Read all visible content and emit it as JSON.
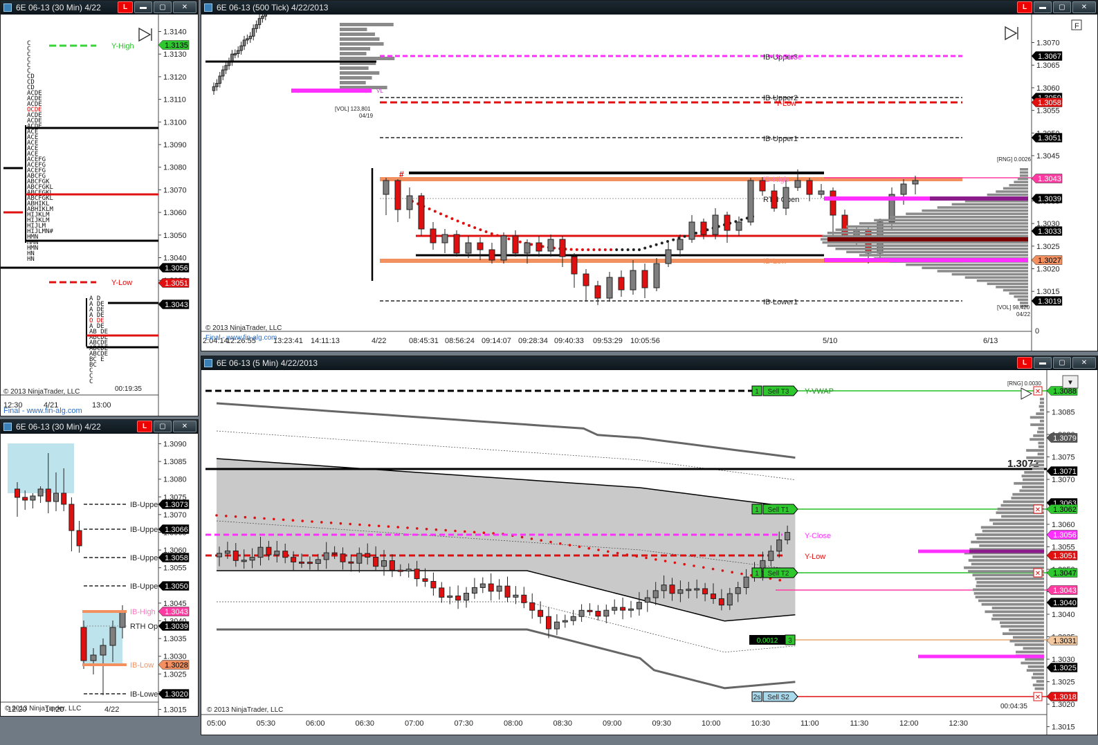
{
  "windows": {
    "tl": {
      "title": "6E 06-13 (30 Min)  4/22",
      "footer": "Final - www.fin-alg.com",
      "copyright": "© 2013 NinjaTrader, LLC",
      "clock": "00:19:35",
      "levels": {
        "y_high": "Y-High",
        "y_low": "Y-Low"
      },
      "prices": [
        "1.3140",
        "1.3130",
        "1.3120",
        "1.3110",
        "1.3100",
        "1.3090",
        "1.3080",
        "1.3070",
        "1.3060",
        "1.3050",
        "1.3040",
        "1.3030",
        "1.3020"
      ],
      "markers": [
        {
          "label": "1.3135",
          "bg": "#2ec82e",
          "fg": "#000"
        },
        {
          "label": "1.3056",
          "bg": "#000",
          "fg": "#fff"
        },
        {
          "label": "1.3051",
          "bg": "#e01010",
          "fg": "#fff"
        },
        {
          "label": "1.3043",
          "bg": "#000",
          "fg": "#fff"
        }
      ],
      "xlabels": [
        "12:30",
        "4/21",
        "13:00"
      ],
      "tpo": [
        "C",
        "C",
        "C",
        "C",
        "C",
        "C",
        "CD",
        "CD",
        "CD",
        "ACDE",
        "ACDE",
        "ACDE",
        "OCDE",
        "ACDE",
        "ACDE",
        "ACDE",
        "ACE",
        "ACE",
        "ACE",
        "ACE",
        "ACE",
        "ACEFG",
        "ACEFG",
        "ACEFG",
        "ABCFG",
        "ABCFGK",
        "ABCFGKL",
        "ABCFGKL",
        "ABCFGKL",
        "ABHIKL",
        "ABHIKLM",
        "HIJKLM",
        "HIJKLM",
        "HIJLM",
        "HIJLMN#",
        "HMN",
        "HMN",
        "HMN",
        "HN",
        "HN"
      ],
      "tpo2": [
        "A  D",
        "A  DE",
        "A  DE",
        "A  DE",
        "O  DE",
        "A  DE",
        "AB DE",
        "ABCDE",
        "ABCDE",
        "ABCDE",
        "ABCDE",
        "BC E",
        "BC",
        "C",
        "C",
        "C"
      ]
    },
    "tr": {
      "title": "6E 06-13 (500 Tick)  4/22/2013",
      "copyright": "© 2013 NinjaTrader, LLC",
      "footer": "Final - www.fin-alg.com",
      "vol1": "[VOL] 123,801",
      "vol1d": "04/19",
      "rng": "[RNG] 0.0026",
      "vol2": "[VOL] 98,420",
      "vol2d": "04/22",
      "vl": "VL",
      "hash": "#",
      "f": "F",
      "levels": {
        "ibu3": "IB-Upper3",
        "yclose": "Y-Close",
        "ibu2": "IB-Upper2",
        "ylow": "Y-Low",
        "ibu1": "IB-Upper1",
        "ibhigh": "IB-High",
        "rth": "RTH Open",
        "iblow": "IB-Low",
        "ibl1": "IB-Lower1"
      },
      "prices": [
        "1.3070",
        "1.3065",
        "1.3060",
        "1.3055",
        "1.3050",
        "1.3045",
        "1.3040",
        "1.3035",
        "1.3030",
        "1.3025",
        "1.3020",
        "1.3015"
      ],
      "markers": [
        {
          "label": "1.3067",
          "bg": "#000",
          "fg": "#fff"
        },
        {
          "label": "1.3059",
          "bg": "#000",
          "fg": "#fff"
        },
        {
          "label": "1.3058",
          "bg": "#e01010",
          "fg": "#fff"
        },
        {
          "label": "1.3051",
          "bg": "#000",
          "fg": "#fff"
        },
        {
          "label": "1.3043",
          "bg": "#ff3aa0",
          "fg": "#fff"
        },
        {
          "label": "1.3039",
          "bg": "#000",
          "fg": "#fff"
        },
        {
          "label": "1.3033",
          "bg": "#000",
          "fg": "#fff"
        },
        {
          "label": "1.3027",
          "bg": "#f39060",
          "fg": "#000"
        },
        {
          "label": "1.3019",
          "bg": "#000",
          "fg": "#fff"
        }
      ],
      "xlabels": [
        "2:04:14",
        "12:26:55",
        "13:23:41",
        "14:11:13",
        "4/22",
        "08:45:31",
        "08:56:24",
        "09:14:07",
        "09:28:34",
        "09:40:33",
        "09:53:29",
        "10:05:56",
        "5/10",
        "6/13"
      ],
      "axis_end": "0"
    },
    "bl": {
      "title": "6E 06-13 (30 Min)  4/22",
      "copyright": "© 2013 NinjaTrader, LLC",
      "levels": {
        "u1": "IB-Uppe",
        "u2": "IB-Uppe",
        "u3": "IB-Uppe",
        "u4": "IB-Uppe",
        "ibhigh": "IB-High",
        "rth": "RTH Op",
        "iblow": "IB-Low",
        "iblower": "IB-Lowe"
      },
      "prices": [
        "1.3090",
        "1.3085",
        "1.3080",
        "1.3075",
        "1.3070",
        "1.3065",
        "1.3060",
        "1.3055",
        "1.3050",
        "1.3045",
        "1.3040",
        "1.3035",
        "1.3030",
        "1.3025",
        "1.3020",
        "1.3015"
      ],
      "markers": [
        {
          "label": "1.3073",
          "bg": "#000",
          "fg": "#fff"
        },
        {
          "label": "1.3066",
          "bg": "#000",
          "fg": "#fff"
        },
        {
          "label": "1.3058",
          "bg": "#000",
          "fg": "#fff"
        },
        {
          "label": "1.3050",
          "bg": "#000",
          "fg": "#fff"
        },
        {
          "label": "1.3043",
          "bg": "#ff3aa0",
          "fg": "#fff"
        },
        {
          "label": "1.3039",
          "bg": "#000",
          "fg": "#fff"
        },
        {
          "label": "1.3028",
          "bg": "#f39060",
          "fg": "#000"
        },
        {
          "label": "1.3020",
          "bg": "#000",
          "fg": "#fff"
        }
      ],
      "xlabels": [
        "12:20",
        "14:20",
        "4/22"
      ]
    },
    "br": {
      "title": "6E 06-13 (5 Min)  4/22/2013",
      "copyright": "© 2013 NinjaTrader, LLC",
      "clock": "00:04:35",
      "rng": "[RNG] 0.0030",
      "big": "1.3072",
      "levels": {
        "yvwap": "Y-VWAP",
        "yclose": "Y-Close",
        "ylow": "Y-Low"
      },
      "orders": [
        {
          "qty": "1",
          "label": "Sell T3"
        },
        {
          "qty": "1",
          "label": "Sell T1"
        },
        {
          "qty": "1",
          "label": "Sell T2"
        },
        {
          "qty": "2s",
          "label": "Sell S2"
        }
      ],
      "pos": {
        "pnl": "0.0012",
        "qty": "3"
      },
      "prices": [
        "1.3085",
        "1.3080",
        "1.3075",
        "1.3070",
        "1.3065",
        "1.3060",
        "1.3055",
        "1.3050",
        "1.3045",
        "1.3040",
        "1.3035",
        "1.3030",
        "1.3025",
        "1.3020",
        "1.3015"
      ],
      "markers": [
        {
          "label": "1.3088",
          "bg": "#2ec82e",
          "fg": "#000"
        },
        {
          "label": "1.3079",
          "bg": "#555",
          "fg": "#fff"
        },
        {
          "label": "1.3071",
          "bg": "#000",
          "fg": "#fff"
        },
        {
          "label": "1.3063",
          "bg": "#000",
          "fg": "#fff"
        },
        {
          "label": "1.3062",
          "bg": "#2ec82e",
          "fg": "#000"
        },
        {
          "label": "1.3056",
          "bg": "#ff30ff",
          "fg": "#fff"
        },
        {
          "label": "1.3051",
          "bg": "#e01010",
          "fg": "#fff"
        },
        {
          "label": "1.3047",
          "bg": "#2ec82e",
          "fg": "#000"
        },
        {
          "label": "1.3043",
          "bg": "#ff3aa0",
          "fg": "#fff"
        },
        {
          "label": "1.3040",
          "bg": "#000",
          "fg": "#fff"
        },
        {
          "label": "1.3031",
          "bg": "#f5c9a0",
          "fg": "#000"
        },
        {
          "label": "1.3025",
          "bg": "#000",
          "fg": "#fff"
        },
        {
          "label": "1.3018",
          "bg": "#e01010",
          "fg": "#fff"
        }
      ],
      "xlabels": [
        "05:00",
        "05:30",
        "06:00",
        "06:30",
        "07:00",
        "07:30",
        "08:00",
        "08:30",
        "09:00",
        "09:30",
        "10:00",
        "10:30",
        "11:00",
        "11:30",
        "12:00",
        "12:30"
      ]
    }
  },
  "colors": {
    "bull": "#7f7f7f",
    "bear": "#e01010",
    "magenta": "#ff30ff",
    "green": "#22c022",
    "orange": "#f39060"
  }
}
